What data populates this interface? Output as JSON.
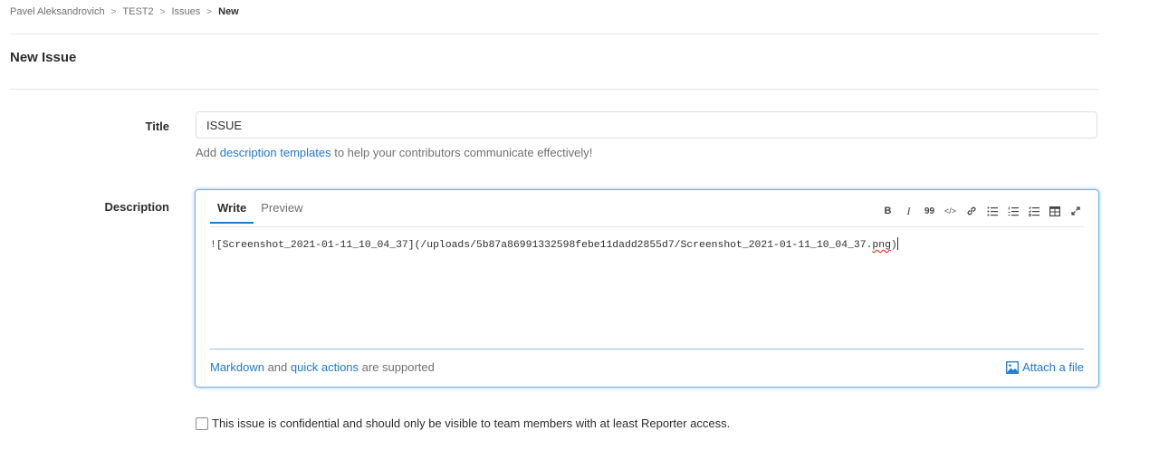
{
  "breadcrumb": {
    "items": [
      "Pavel Aleksandrovich",
      "TEST2",
      "Issues"
    ],
    "current": "New",
    "separator": ">"
  },
  "page": {
    "title": "New Issue"
  },
  "title_field": {
    "label": "Title",
    "value": "ISSUE"
  },
  "help": {
    "prefix": "Add ",
    "link": "description templates",
    "suffix": " to help your contributors communicate effectively!"
  },
  "description": {
    "label": "Description",
    "tabs": {
      "write": "Write",
      "preview": "Preview"
    },
    "toolbar": {
      "bold": "B",
      "italic": "I",
      "quote": "99",
      "code": "</>",
      "icons": [
        "bold-icon",
        "italic-icon",
        "quote-icon",
        "code-icon",
        "link-icon",
        "bullet-list-icon",
        "numbered-list-icon",
        "task-list-icon",
        "table-icon",
        "fullscreen-icon"
      ]
    },
    "content_main": "![Screenshot_2021-01-11_10_04_37](/uploads/5b87a86991332598febe11dadd2855d7/Screenshot_2021-01-11_10_04_37.",
    "content_ext": "png",
    "content_end": ")",
    "footer": {
      "markdown_link": "Markdown",
      "and": " and ",
      "quick_actions_link": "quick actions",
      "supported": " are supported",
      "attach": "Attach a file"
    }
  },
  "confidential": {
    "label": "This issue is confidential and should only be visible to team members with at least Reporter access.",
    "checked": false
  },
  "colors": {
    "link": "#1f78d1",
    "focus_border": "#73afea",
    "text": "#2e2e2e",
    "muted": "#707070"
  }
}
